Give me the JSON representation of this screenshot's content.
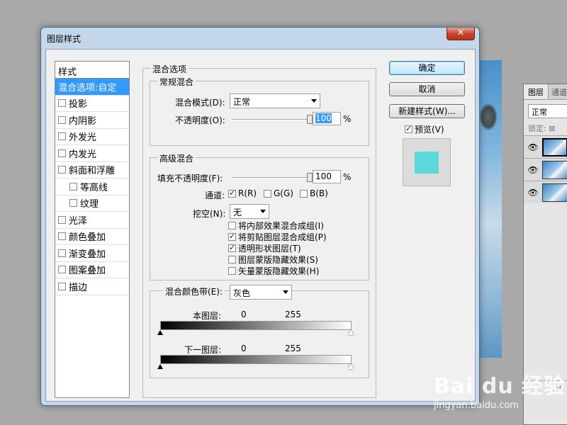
{
  "dialog": {
    "title": "图层样式",
    "close": "✕"
  },
  "styles": {
    "header": "样式",
    "items": [
      {
        "label": "混合选项:自定",
        "checkbox": false,
        "selected": true,
        "indent": false
      },
      {
        "label": "投影",
        "checkbox": true,
        "checked": false,
        "indent": false
      },
      {
        "label": "内阴影",
        "checkbox": true,
        "checked": false,
        "indent": false
      },
      {
        "label": "外发光",
        "checkbox": true,
        "checked": false,
        "indent": false
      },
      {
        "label": "内发光",
        "checkbox": true,
        "checked": false,
        "indent": false
      },
      {
        "label": "斜面和浮雕",
        "checkbox": true,
        "checked": false,
        "indent": false
      },
      {
        "label": "等高线",
        "checkbox": true,
        "checked": false,
        "indent": true
      },
      {
        "label": "纹理",
        "checkbox": true,
        "checked": false,
        "indent": true
      },
      {
        "label": "光泽",
        "checkbox": true,
        "checked": false,
        "indent": false
      },
      {
        "label": "颜色叠加",
        "checkbox": true,
        "checked": false,
        "indent": false
      },
      {
        "label": "渐变叠加",
        "checkbox": true,
        "checked": false,
        "indent": false
      },
      {
        "label": "图案叠加",
        "checkbox": true,
        "checked": false,
        "indent": false
      },
      {
        "label": "描边",
        "checkbox": true,
        "checked": false,
        "indent": false
      }
    ]
  },
  "blending": {
    "group_title": "混合选项",
    "general": {
      "title": "常规混合",
      "mode_label": "混合模式(D):",
      "mode_value": "正常",
      "opacity_label": "不透明度(O):",
      "opacity_value": "100",
      "opacity_fraction": 1.0,
      "unit": "%"
    },
    "advanced": {
      "title": "高级混合",
      "fill_label": "填充不透明度(F):",
      "fill_value": "100",
      "fill_fraction": 1.0,
      "unit": "%",
      "channels_label": "通道:",
      "channels": [
        {
          "label": "R(R)",
          "checked": true
        },
        {
          "label": "G(G)",
          "checked": false
        },
        {
          "label": "B(B)",
          "checked": false
        }
      ],
      "knockout_label": "挖空(N):",
      "knockout_value": "无",
      "options": [
        {
          "label": "将内部效果混合成组(I)",
          "checked": false
        },
        {
          "label": "将剪贴图层混合成组(P)",
          "checked": true
        },
        {
          "label": "透明形状图层(T)",
          "checked": true
        },
        {
          "label": "图层蒙版隐藏效果(S)",
          "checked": false
        },
        {
          "label": "矢量蒙版隐藏效果(H)",
          "checked": false
        }
      ]
    },
    "blend_if": {
      "label": "混合颜色带(E):",
      "value": "灰色",
      "this_layer": "本图层:",
      "underlying": "下一图层:",
      "min": "0",
      "max": "255"
    }
  },
  "buttons": {
    "ok": "确定",
    "cancel": "取消",
    "new_style": "新建样式(W)...",
    "preview_label": "预览(V)",
    "preview_checked": true
  },
  "colors": {
    "preview_swatch": "#5ad8da",
    "selection": "#3399ff"
  },
  "layers_panel": {
    "tab1": "图层",
    "tab2": "通道",
    "mode": "正常",
    "lock": "锁定:"
  },
  "watermark": {
    "brand": "Bai du 经验",
    "url": "jingyan.baidu.com"
  }
}
